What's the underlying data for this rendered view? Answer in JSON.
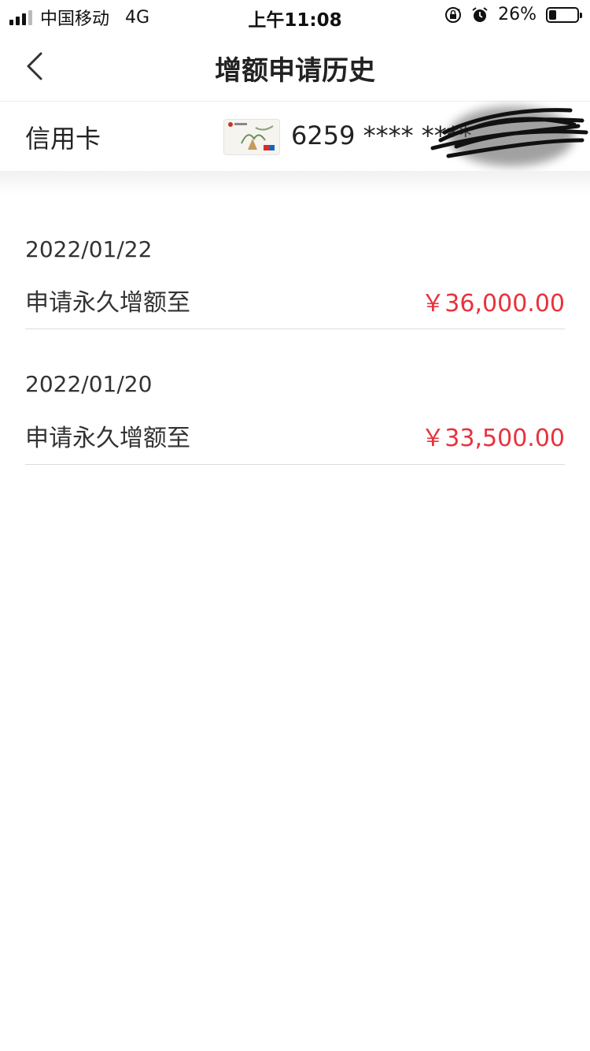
{
  "status_bar": {
    "carrier": "中国移动",
    "network": "4G",
    "time": "上午11:08",
    "battery_percent": "26%",
    "battery_level": 0.26,
    "icons": [
      "signal-icon",
      "rotation-lock-icon",
      "alarm-icon",
      "battery-icon"
    ]
  },
  "nav": {
    "back_icon": "chevron-left-icon",
    "title": "增额申请历史"
  },
  "card": {
    "label": "信用卡",
    "number": "6259 **** ****"
  },
  "records": [
    {
      "date": "2022/01/22",
      "label": "申请永久增额至",
      "amount": "￥36,000.00"
    },
    {
      "date": "2022/01/20",
      "label": "申请永久增额至",
      "amount": "￥33,500.00"
    }
  ],
  "colors": {
    "amount": "#e8323c",
    "text": "#222222",
    "divider": "#dcdcdc"
  }
}
